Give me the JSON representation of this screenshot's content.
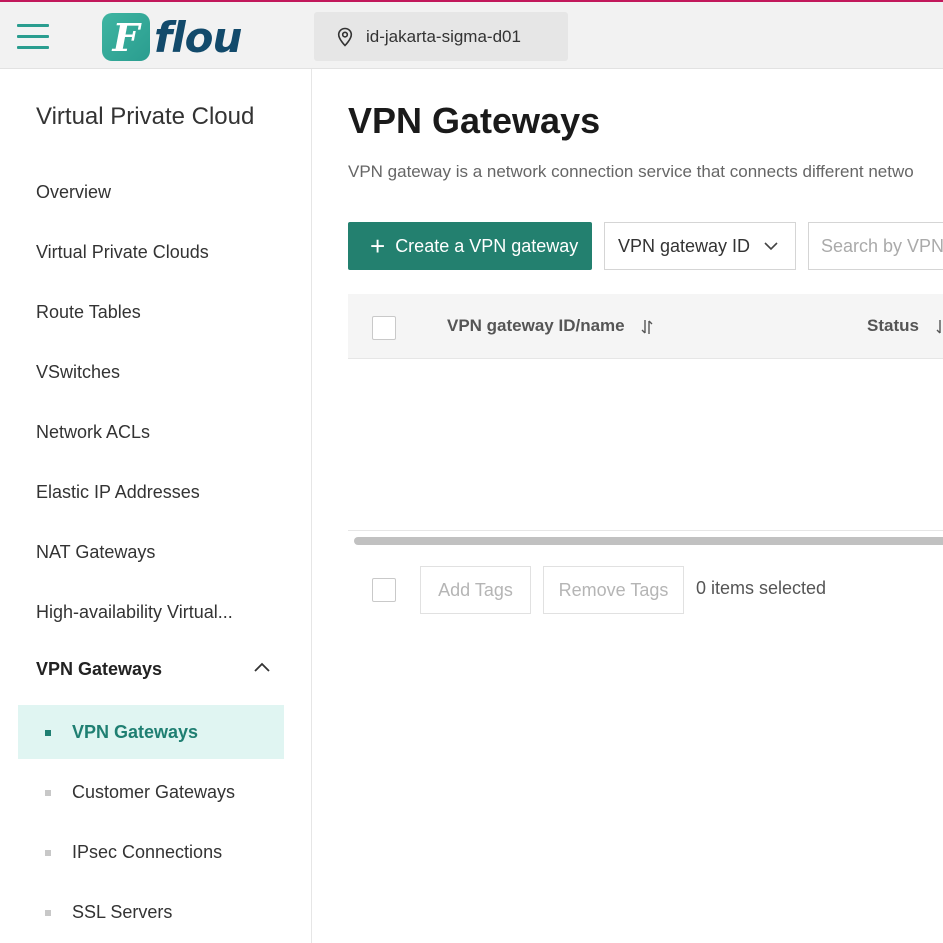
{
  "header": {
    "logo_text": "flou",
    "logo_mark": "F",
    "region": "id-jakarta-sigma-d01",
    "menu_icon": "hamburger-menu-icon",
    "region_icon": "location-pin-icon"
  },
  "sidebar": {
    "title": "Virtual Private Cloud",
    "items": [
      {
        "label": "Overview"
      },
      {
        "label": "Virtual Private Clouds"
      },
      {
        "label": "Route Tables"
      },
      {
        "label": "VSwitches"
      },
      {
        "label": "Network ACLs"
      },
      {
        "label": "Elastic IP Addresses"
      },
      {
        "label": "NAT Gateways"
      },
      {
        "label": "High-availability Virtual..."
      }
    ],
    "group": {
      "label": "VPN Gateways",
      "expanded": true,
      "children": [
        {
          "label": "VPN Gateways",
          "active": true
        },
        {
          "label": "Customer Gateways",
          "active": false
        },
        {
          "label": "IPsec Connections",
          "active": false
        },
        {
          "label": "SSL Servers",
          "active": false
        }
      ]
    }
  },
  "main": {
    "title": "VPN Gateways",
    "description": "VPN gateway is a network connection service that connects different netwo",
    "create_button": "Create a VPN gateway",
    "filter_select": "VPN gateway ID",
    "search_placeholder": "Search by VPN",
    "table": {
      "columns": [
        "VPN gateway ID/name",
        "Status"
      ],
      "rows": []
    },
    "bulk": {
      "add_tags": "Add Tags",
      "remove_tags": "Remove Tags",
      "selected_text": "0 items selected"
    }
  },
  "colors": {
    "accent": "#23806f",
    "accent_light": "#e0f5f2",
    "top_border": "#c2185b",
    "logo_text": "#124a6b"
  }
}
